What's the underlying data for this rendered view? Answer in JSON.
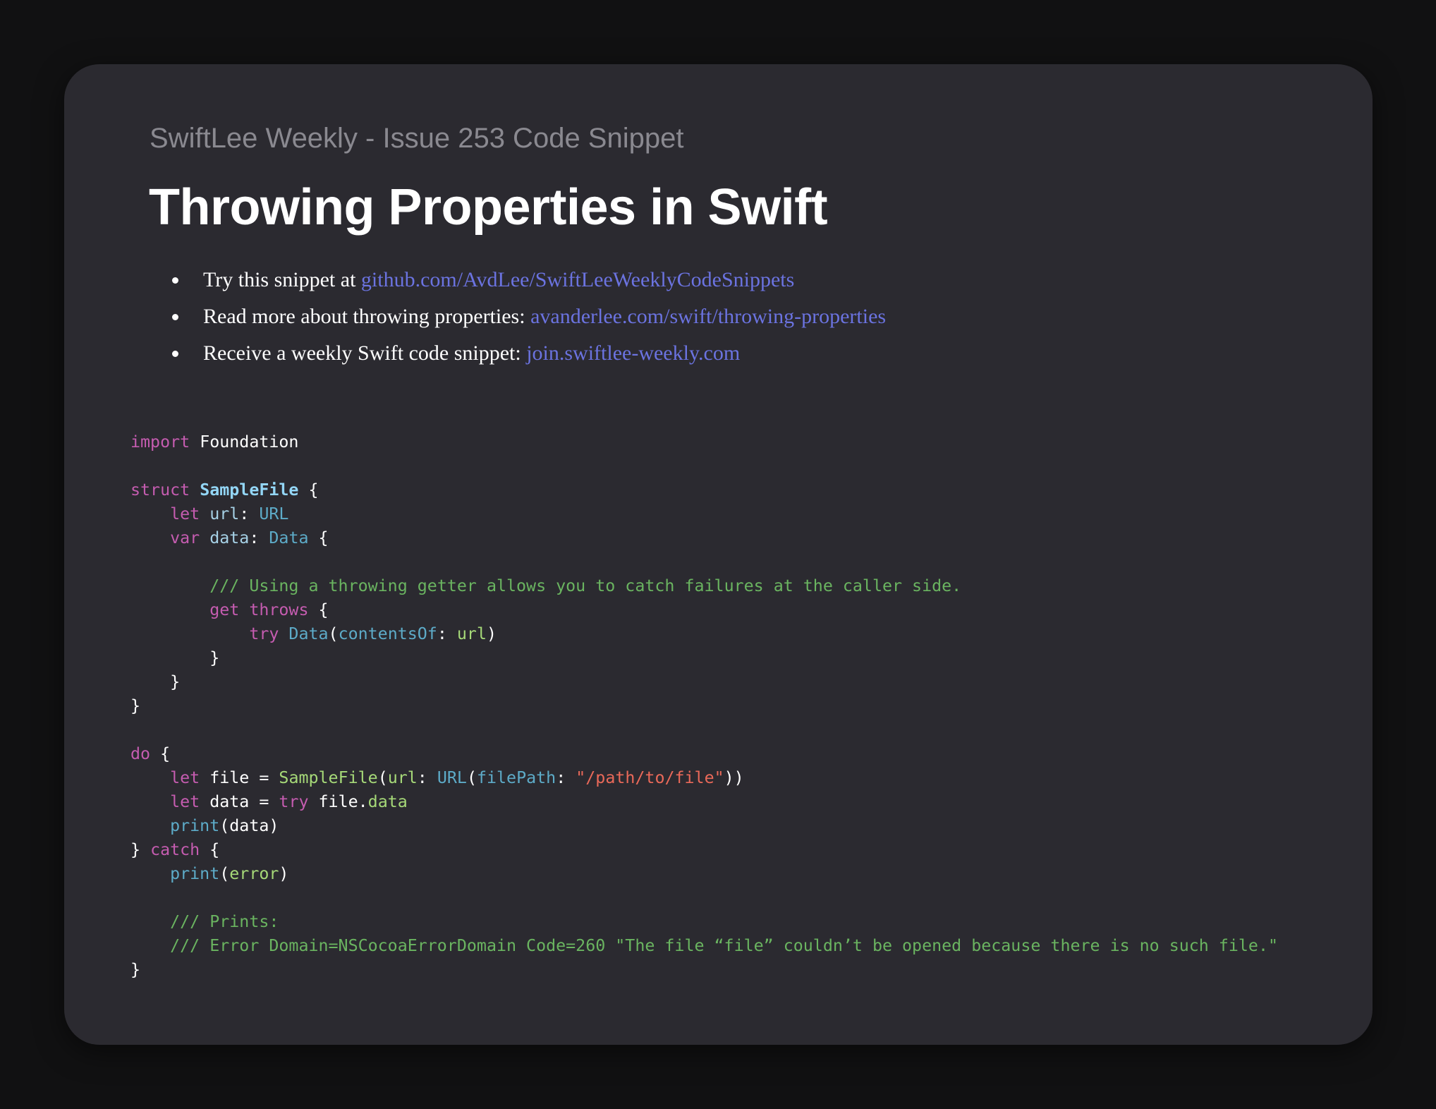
{
  "header": {
    "subtitle": "SwiftLee Weekly - Issue 253 Code Snippet",
    "title": "Throwing Properties in Swift"
  },
  "bullets": [
    {
      "text": "Try this snippet at ",
      "link": "github.com/AvdLee/SwiftLeeWeeklyCodeSnippets"
    },
    {
      "text": "Read more about throwing properties: ",
      "link": "avanderlee.com/swift/throwing-properties"
    },
    {
      "text": "Receive a weekly Swift code snippet: ",
      "link": "join.swiftlee-weekly.com"
    }
  ],
  "code": {
    "language": "swift",
    "lines": [
      "import Foundation",
      "",
      "struct SampleFile {",
      "    let url: URL",
      "    var data: Data {",
      "",
      "        /// Using a throwing getter allows you to catch failures at the caller side.",
      "        get throws {",
      "            try Data(contentsOf: url)",
      "        }",
      "    }",
      "}",
      "",
      "do {",
      "    let file = SampleFile(url: URL(filePath: \"/path/to/file\"))",
      "    let data = try file.data",
      "    print(data)",
      "} catch {",
      "    print(error)",
      "",
      "    /// Prints:",
      "    /// Error Domain=NSCocoaErrorDomain Code=260 \"The file “file” couldn’t be opened because there is no such file.\"",
      "}"
    ]
  },
  "colors": {
    "background": "#111112",
    "card": "#2b2a30",
    "link": "#6b73e0",
    "keyword": "#c55cb0",
    "type": "#5dabc8",
    "string": "#ea6959",
    "comment": "#6ab460"
  }
}
